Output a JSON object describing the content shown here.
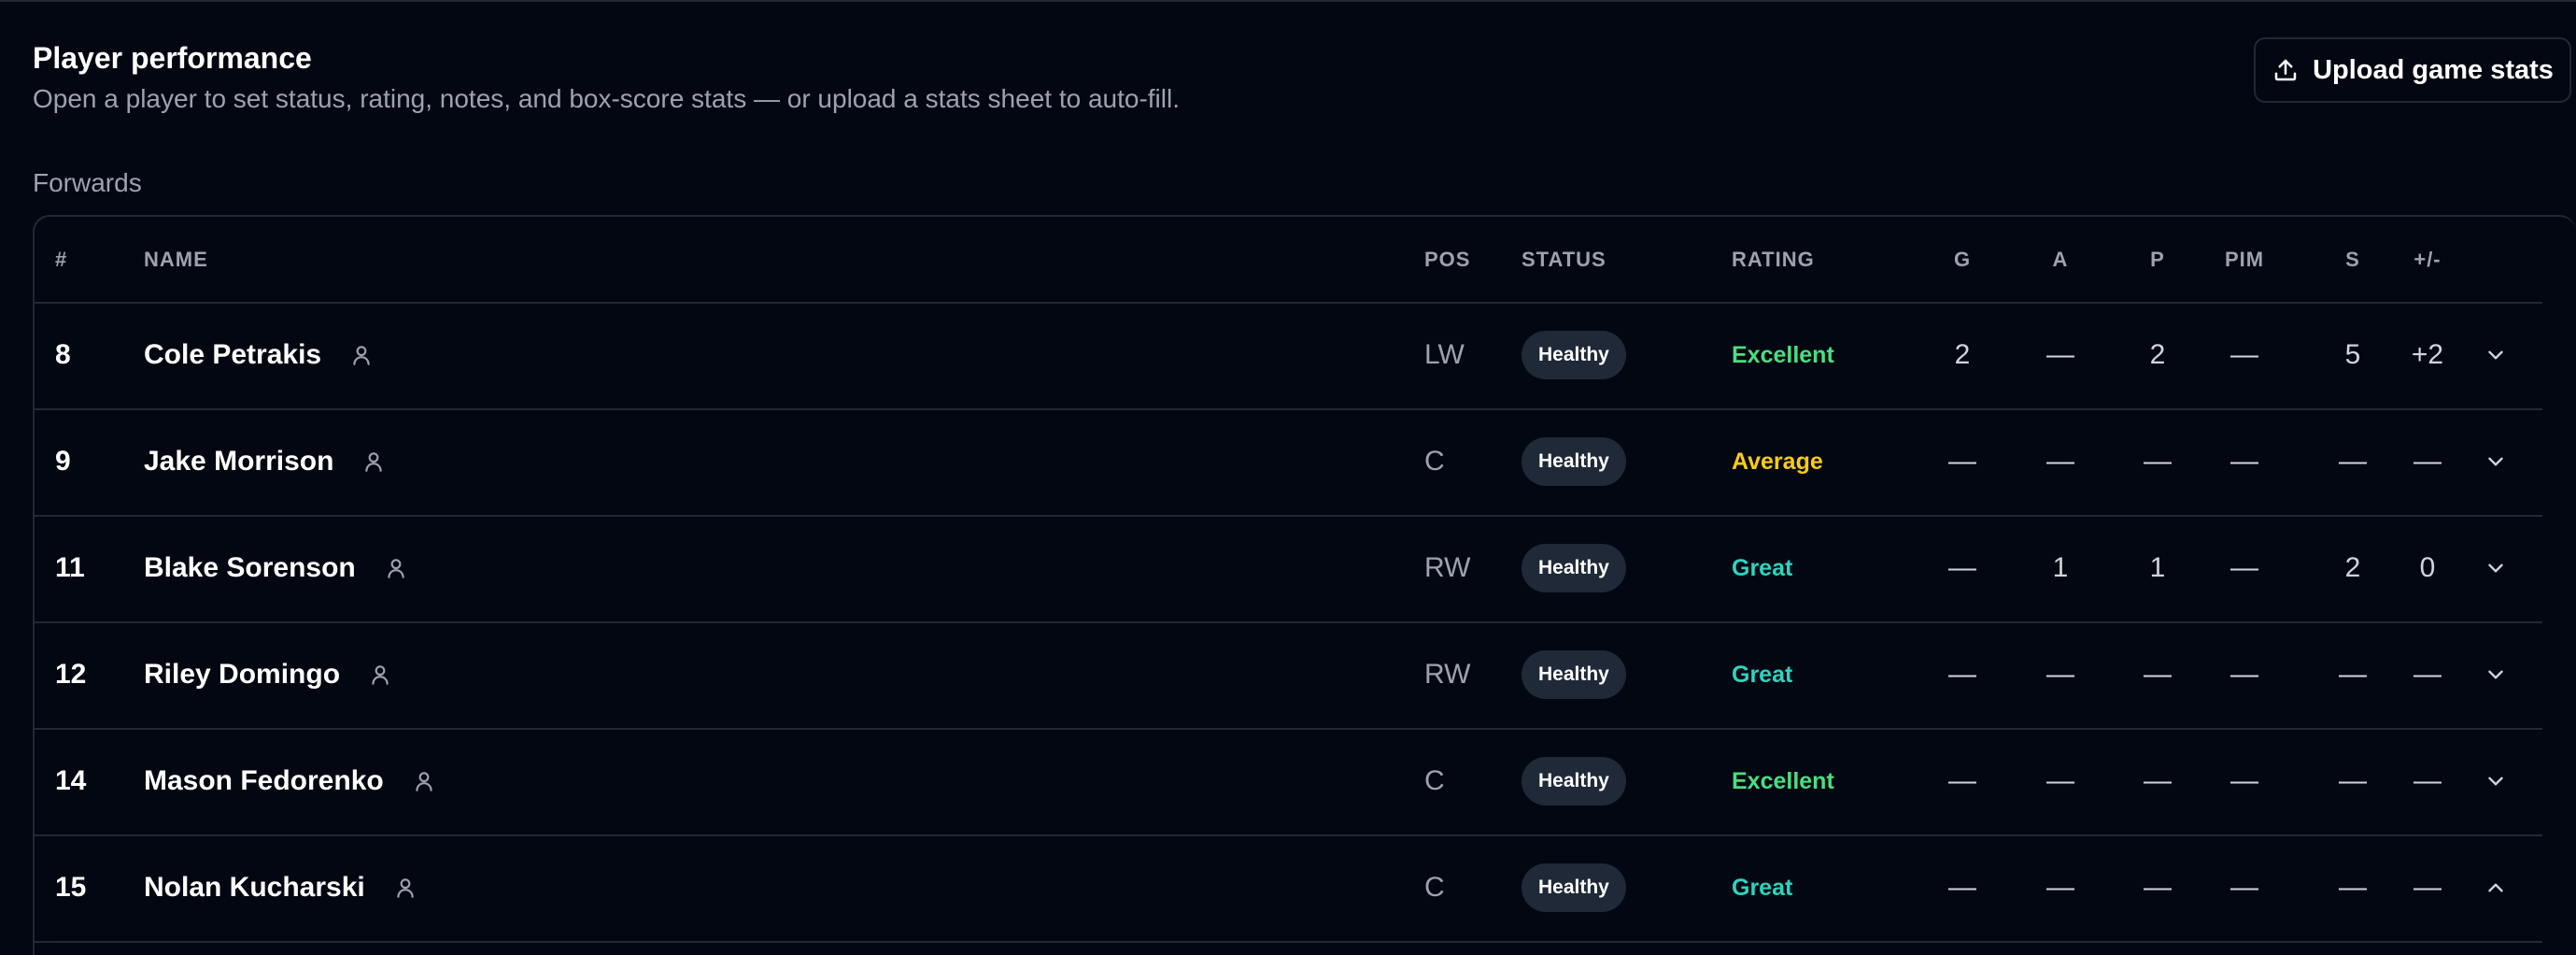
{
  "header": {
    "title": "Player performance",
    "subtitle": "Open a player to set status, rating, notes, and box-score stats — or upload a stats sheet to auto-fill.",
    "upload_label": "Upload game stats"
  },
  "section": {
    "label": "Forwards"
  },
  "columns": {
    "num": "#",
    "name": "NAME",
    "pos": "POS",
    "status": "STATUS",
    "rating": "RATING",
    "g": "G",
    "a": "A",
    "p": "P",
    "pim": "PIM",
    "s": "S",
    "pm": "+/-"
  },
  "colors": {
    "excellent": "#4ade80",
    "average": "#facc15",
    "great": "#2dd4bf"
  },
  "players": [
    {
      "num": "8",
      "name": "Cole Petrakis",
      "pos": "LW",
      "status": "Healthy",
      "rating": "Excellent",
      "g": "2",
      "a": "—",
      "p": "2",
      "pim": "—",
      "s": "5",
      "pm": "+2",
      "expanded": false
    },
    {
      "num": "9",
      "name": "Jake Morrison",
      "pos": "C",
      "status": "Healthy",
      "rating": "Average",
      "g": "—",
      "a": "—",
      "p": "—",
      "pim": "—",
      "s": "—",
      "pm": "—",
      "expanded": false
    },
    {
      "num": "11",
      "name": "Blake Sorenson",
      "pos": "RW",
      "status": "Healthy",
      "rating": "Great",
      "g": "—",
      "a": "1",
      "p": "1",
      "pim": "—",
      "s": "2",
      "pm": "0",
      "expanded": false
    },
    {
      "num": "12",
      "name": "Riley Domingo",
      "pos": "RW",
      "status": "Healthy",
      "rating": "Great",
      "g": "—",
      "a": "—",
      "p": "—",
      "pim": "—",
      "s": "—",
      "pm": "—",
      "expanded": false
    },
    {
      "num": "14",
      "name": "Mason Fedorenko",
      "pos": "C",
      "status": "Healthy",
      "rating": "Excellent",
      "g": "—",
      "a": "—",
      "p": "—",
      "pim": "—",
      "s": "—",
      "pm": "—",
      "expanded": false
    },
    {
      "num": "15",
      "name": "Nolan Kucharski",
      "pos": "C",
      "status": "Healthy",
      "rating": "Great",
      "g": "—",
      "a": "—",
      "p": "—",
      "pim": "—",
      "s": "—",
      "pm": "—",
      "expanded": true
    }
  ],
  "icons": {
    "upload": "upload-icon",
    "player": "user-icon",
    "expand": "chevron-down-icon",
    "collapse": "chevron-up-icon"
  }
}
